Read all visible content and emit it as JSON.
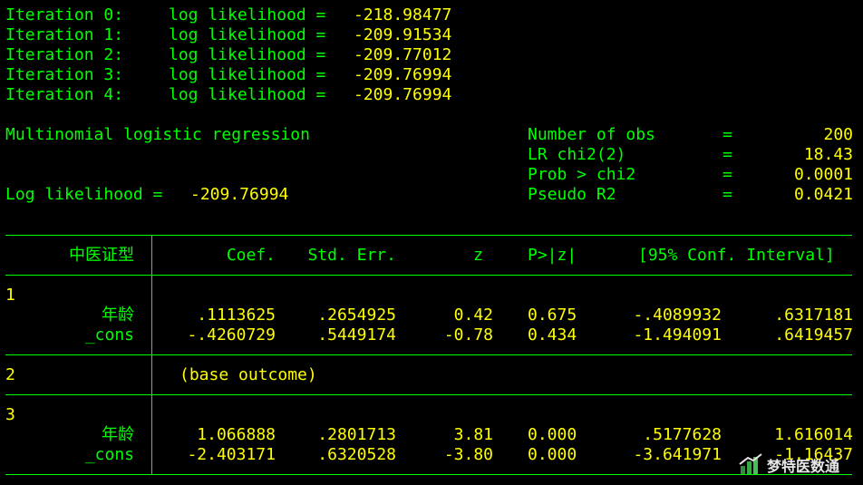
{
  "iterations": [
    {
      "label": "Iteration 0:",
      "text": "log likelihood =",
      "value": "-218.98477"
    },
    {
      "label": "Iteration 1:",
      "text": "log likelihood =",
      "value": "-209.91534"
    },
    {
      "label": "Iteration 2:",
      "text": "log likelihood =",
      "value": "-209.77012"
    },
    {
      "label": "Iteration 3:",
      "text": "log likelihood =",
      "value": "-209.76994"
    },
    {
      "label": "Iteration 4:",
      "text": "log likelihood =",
      "value": "-209.76994"
    }
  ],
  "model": {
    "title": "Multinomial logistic regression",
    "loglik_label": "Log likelihood =",
    "loglik_value": "-209.76994"
  },
  "stats": [
    {
      "label": "Number of obs",
      "eq": "=",
      "value": "200"
    },
    {
      "label": "LR chi2(2)",
      "eq": "=",
      "value": "18.43"
    },
    {
      "label": "Prob > chi2",
      "eq": "=",
      "value": "0.0001"
    },
    {
      "label": "Pseudo R2",
      "eq": "=",
      "value": "0.0421"
    }
  ],
  "table": {
    "header": {
      "var": "中医证型",
      "coef": "Coef.",
      "se": "Std. Err.",
      "z": "z",
      "p": "P>|z|",
      "ci": "[95% Conf. Interval]"
    },
    "groups": [
      {
        "id": "1",
        "rows": [
          {
            "var": "年龄",
            "coef": ".1113625",
            "se": ".2654925",
            "z": "0.42",
            "p": "0.675",
            "lo": "-.4089932",
            "hi": ".6317181"
          },
          {
            "var": "_cons",
            "coef": "-.4260729",
            "se": ".5449174",
            "z": "-0.78",
            "p": "0.434",
            "lo": "-1.494091",
            "hi": ".6419457"
          }
        ]
      },
      {
        "id": "2",
        "base": "(base outcome)"
      },
      {
        "id": "3",
        "rows": [
          {
            "var": "年龄",
            "coef": "1.066888",
            "se": ".2801713",
            "z": "3.81",
            "p": "0.000",
            "lo": ".5177628",
            "hi": "1.616014"
          },
          {
            "var": "_cons",
            "coef": "-2.403171",
            "se": ".6320528",
            "z": "-3.80",
            "p": "0.000",
            "lo": "-3.641971",
            "hi": "-1.16437"
          }
        ]
      }
    ]
  },
  "watermark": {
    "text": "梦特医数通",
    "icon": "bar-chart-logo-icon"
  }
}
